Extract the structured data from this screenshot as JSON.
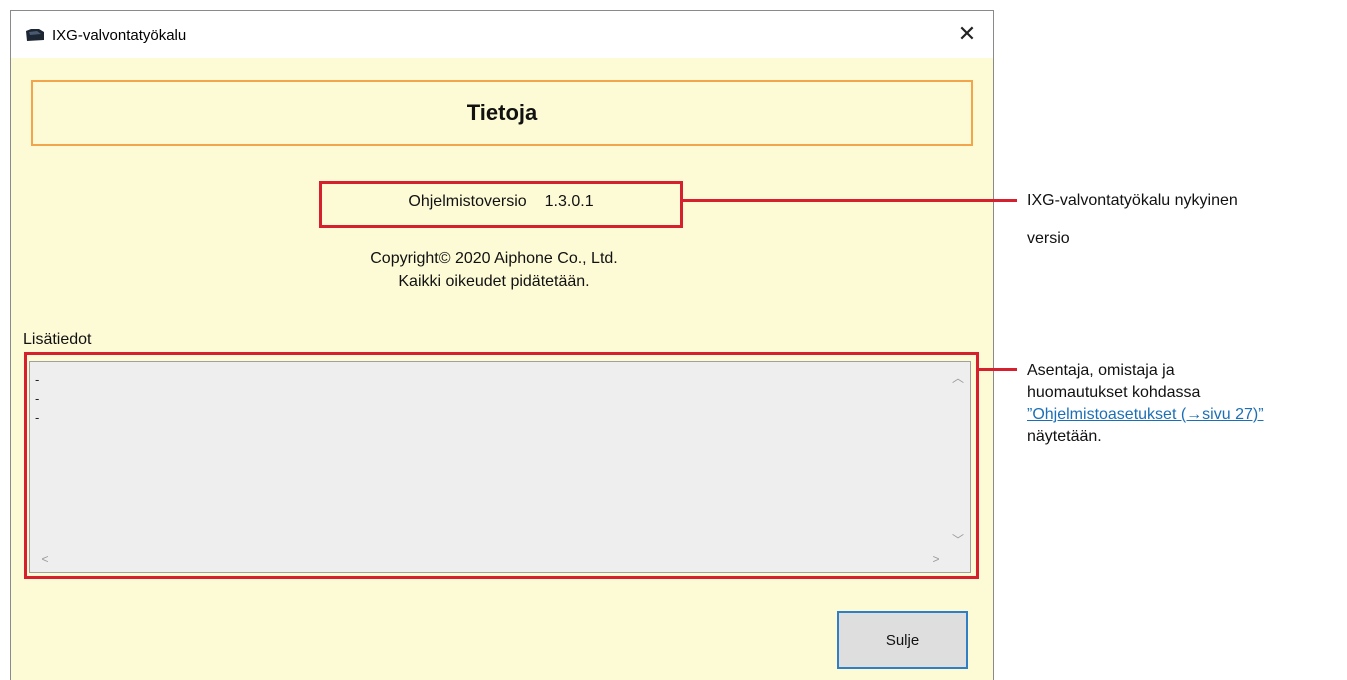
{
  "window": {
    "title": "IXG-valvontatyökalu",
    "close_glyph": "✕"
  },
  "header": {
    "title": "Tietoja"
  },
  "version": {
    "label": "Ohjelmistoversio",
    "value": "1.3.0.1"
  },
  "copyright": {
    "line1": "Copyright© 2020 Aiphone Co., Ltd.",
    "line2": "Kaikki oikeudet pidätetään."
  },
  "info": {
    "label": "Lisätiedot",
    "lines": [
      "-",
      "-",
      "-"
    ]
  },
  "buttons": {
    "close_label": "Sulje"
  },
  "annotations": {
    "version_note_line1": "IXG-valvontatyökalu nykyinen",
    "version_note_line2": "versio",
    "info_note_line1": "Asentaja, omistaja ja",
    "info_note_line2": "huomautukset kohdassa",
    "info_note_link": "”Ohjelmistoasetukset (→sivu 27)”",
    "info_note_line4": "näytetään."
  },
  "colors": {
    "window_bg": "#fdfbd6",
    "header_border": "#f2a54a",
    "highlight_red": "#d7202e",
    "button_border": "#2f7fc6",
    "link": "#1c6fb5"
  }
}
